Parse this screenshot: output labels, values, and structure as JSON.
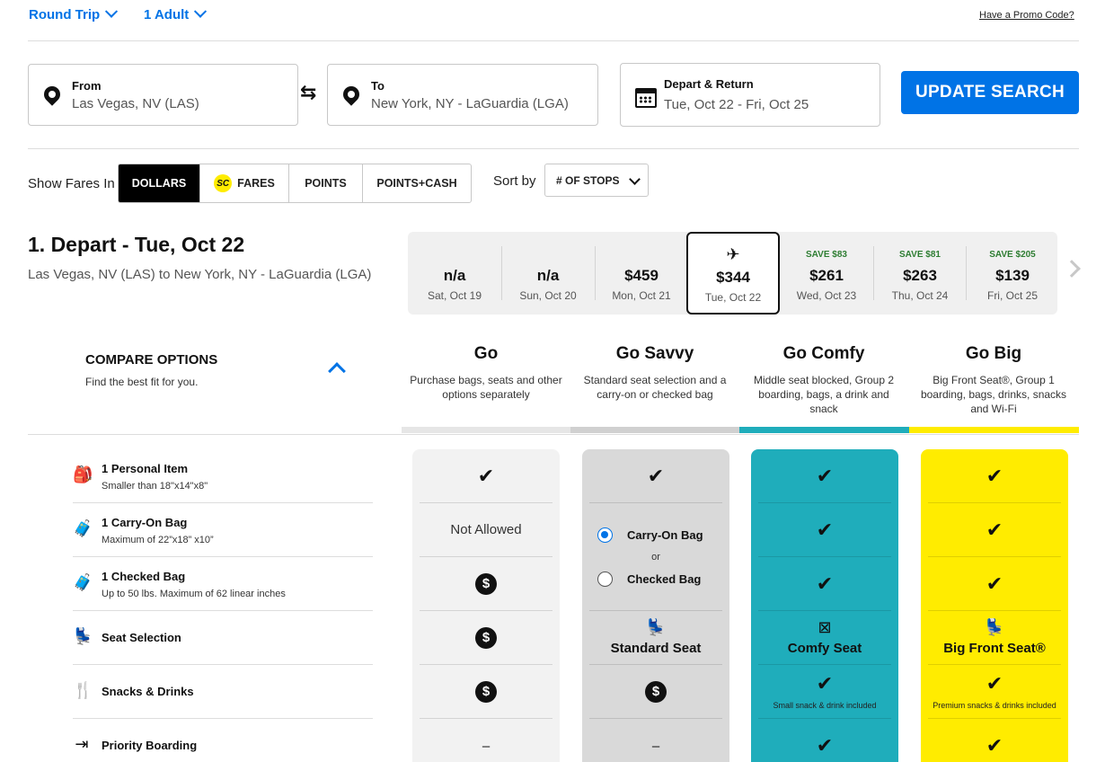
{
  "header": {
    "trip_type": "Round Trip",
    "passengers": "1 Adult",
    "promo_link": "Have a Promo Code?"
  },
  "search": {
    "from_label": "From",
    "from_value": "Las Vegas, NV (LAS)",
    "to_label": "To",
    "to_value": "New York, NY - LaGuardia (LGA)",
    "dates_label": "Depart & Return",
    "dates_value": "Tue, Oct 22 - Fri, Oct 25",
    "update_button": "UPDATE SEARCH"
  },
  "fares": {
    "label": "Show Fares In",
    "options": [
      "DOLLARS",
      "FARES",
      "POINTS",
      "POINTS+CASH"
    ],
    "sc_badge": "SC",
    "selected": "DOLLARS",
    "sort_label": "Sort by",
    "sort_value": "# OF STOPS"
  },
  "depart": {
    "title": "1. Depart - Tue, Oct 22",
    "route": "Las Vegas, NV (LAS) to New York, NY - LaGuardia (LGA)"
  },
  "dates": [
    {
      "save": "",
      "price": "n/a",
      "date": "Sat, Oct 19"
    },
    {
      "save": "",
      "price": "n/a",
      "date": "Sun, Oct 20"
    },
    {
      "save": "",
      "price": "$459",
      "date": "Mon, Oct 21"
    },
    {
      "save": "",
      "price": "$344",
      "date": "Tue, Oct 22",
      "selected": true
    },
    {
      "save": "SAVE $83",
      "price": "$261",
      "date": "Wed, Oct 23"
    },
    {
      "save": "SAVE $81",
      "price": "$263",
      "date": "Thu, Oct 24"
    },
    {
      "save": "SAVE $205",
      "price": "$139",
      "date": "Fri, Oct 25"
    }
  ],
  "compare": {
    "title": "COMPARE OPTIONS",
    "subtitle": "Find the best fit for you."
  },
  "bundles": [
    {
      "name": "Go",
      "desc": "Purchase bags, seats and other options separately",
      "color": "#f2f2f2",
      "bar": "#e6e6e6"
    },
    {
      "name": "Go Savvy",
      "desc": "Standard seat selection and a carry-on or checked bag",
      "color": "#d9d9d9",
      "bar": "#d0d0d0"
    },
    {
      "name": "Go Comfy",
      "desc": "Middle seat blocked, Group 2 boarding, bags, a drink and snack",
      "color": "#1fadbb",
      "bar": "#1fadbb"
    },
    {
      "name": "Go Big",
      "desc": "Big Front Seat®, Group 1 boarding, bags, drinks, snacks and Wi-Fi",
      "color": "#ffec00",
      "bar": "#ffec00"
    }
  ],
  "features": [
    {
      "title": "1 Personal Item",
      "sub": "Smaller than 18\"x14\"x8\""
    },
    {
      "title": "1 Carry-On Bag",
      "sub": "Maximum of 22”x18” x10”"
    },
    {
      "title": "1 Checked Bag",
      "sub": "Up to 50 lbs. Maximum of 62 linear inches"
    },
    {
      "title": "Seat Selection",
      "sub": ""
    },
    {
      "title": "Snacks & Drinks",
      "sub": ""
    },
    {
      "title": "Priority Boarding",
      "sub": ""
    }
  ],
  "cells": {
    "not_allowed": "Not Allowed",
    "carry_on_option": "Carry-On Bag",
    "or": "or",
    "checked_option": "Checked Bag",
    "standard_seat": "Standard Seat",
    "comfy_seat": "Comfy Seat",
    "big_front_seat": "Big Front Seat®",
    "small_snack": "Small snack & drink included",
    "premium_snack": "Premium snacks & drinks included",
    "dash": "–"
  }
}
